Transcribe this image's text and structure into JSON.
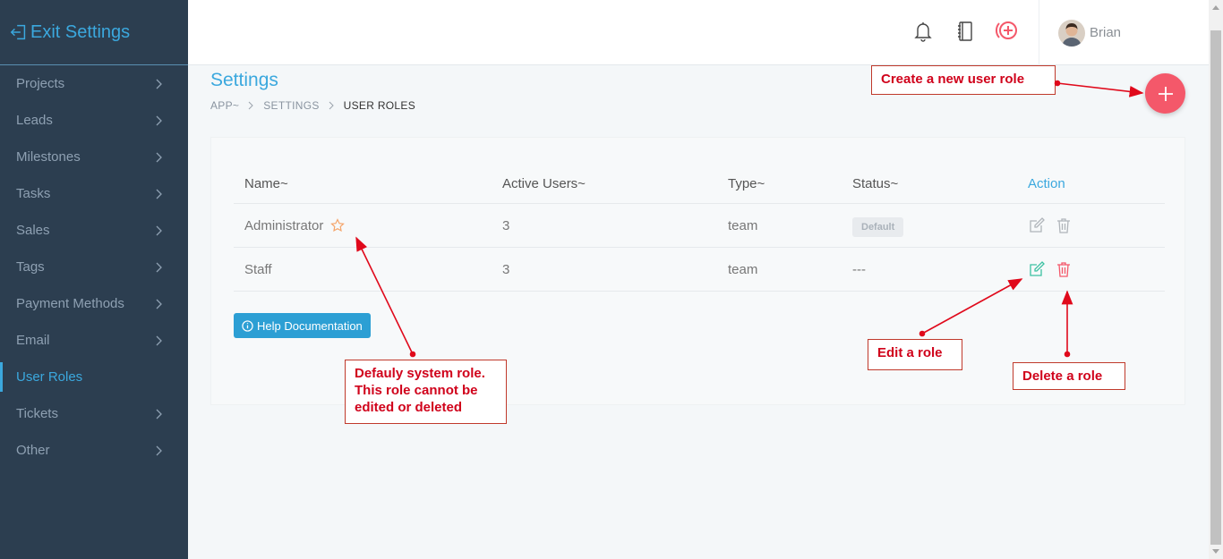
{
  "sidebar": {
    "exit_label": "Exit Settings",
    "items": [
      {
        "label": "Projects",
        "has_chevron": true
      },
      {
        "label": "Leads",
        "has_chevron": true
      },
      {
        "label": "Milestones",
        "has_chevron": true
      },
      {
        "label": "Tasks",
        "has_chevron": true
      },
      {
        "label": "Sales",
        "has_chevron": true
      },
      {
        "label": "Tags",
        "has_chevron": true
      },
      {
        "label": "Payment Methods",
        "has_chevron": true
      },
      {
        "label": "Email",
        "has_chevron": true
      },
      {
        "label": "User Roles",
        "has_chevron": false,
        "active": true
      },
      {
        "label": "Tickets",
        "has_chevron": true
      },
      {
        "label": "Other",
        "has_chevron": true
      }
    ]
  },
  "topbar": {
    "icons": [
      "bell-icon",
      "notebook-icon",
      "add-circle-icon"
    ],
    "user_name": "Brian"
  },
  "page": {
    "title": "Settings",
    "breadcrumb": [
      "APP~",
      "SETTINGS",
      "USER ROLES"
    ]
  },
  "table": {
    "headers": {
      "name": "Name~",
      "active_users": "Active Users~",
      "type": "Type~",
      "status": "Status~",
      "action": "Action"
    },
    "rows": [
      {
        "name": "Administrator",
        "active_users": "3",
        "type": "team",
        "status": "Default",
        "status_is_badge": true,
        "starred": true,
        "editable": false
      },
      {
        "name": "Staff",
        "active_users": "3",
        "type": "team",
        "status": "---",
        "status_is_badge": false,
        "starred": false,
        "editable": true
      }
    ]
  },
  "help_button": "Help Documentation",
  "annotations": {
    "create_role": "Create a new user role",
    "default_role": "Defauly system role. This role cannot be edited or deleted",
    "edit_role": "Edit a role",
    "delete_role": "Delete a role"
  },
  "colors": {
    "sidebar_bg": "#2c3e50",
    "accent": "#3ba8de",
    "fab": "#f4586a",
    "annotation": "#d0021b",
    "edit_active": "#3cc1a2",
    "delete_active": "#f4586a"
  }
}
